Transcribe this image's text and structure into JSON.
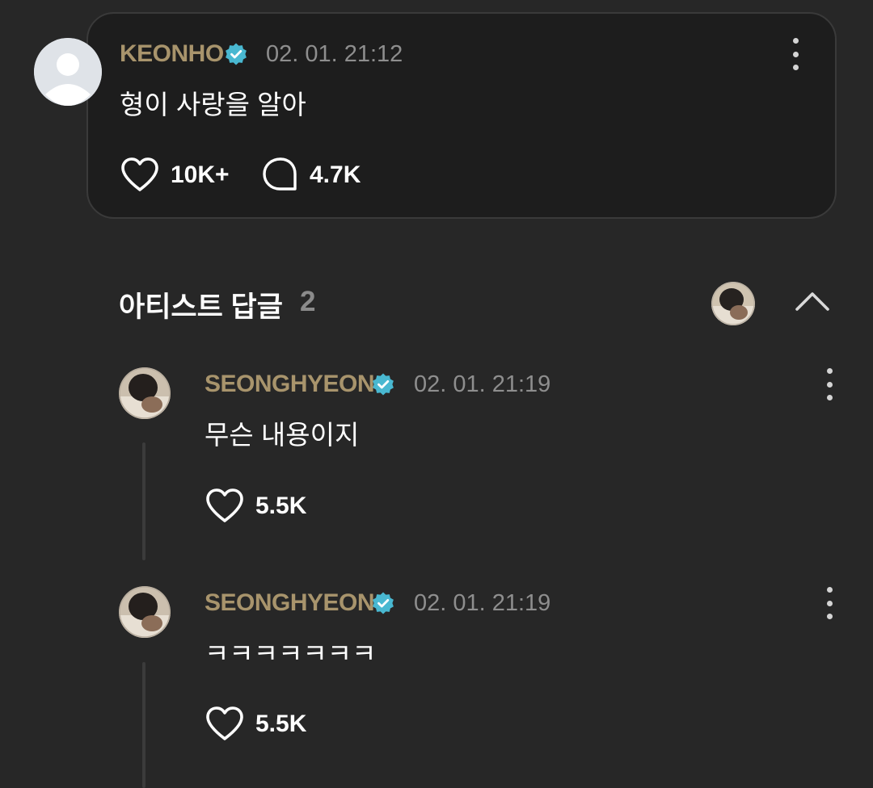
{
  "post": {
    "author": "KEONHO",
    "timestamp": "02. 01. 21:12",
    "text": "형이 사랑을 알아",
    "like_count": "10K+",
    "comment_count": "4.7K"
  },
  "replies_section": {
    "title": "아티스트 답글",
    "count": "2"
  },
  "replies": [
    {
      "author": "SEONGHYEON",
      "timestamp": "02. 01. 21:19",
      "text": "무슨 내용이지",
      "like_count": "5.5K"
    },
    {
      "author": "SEONGHYEON",
      "timestamp": "02. 01. 21:19",
      "text": "ㅋㅋㅋㅋㅋㅋㅋ",
      "like_count": "5.5K"
    }
  ],
  "colors": {
    "background": "#272727",
    "card": "#1d1d1d",
    "author_name": "#a8946c",
    "verified_badge": "#49b8d1",
    "timestamp": "#8e8e8e"
  },
  "icons": {
    "verified": "verified-badge-icon",
    "more": "more-vertical-icon",
    "like": "heart-outline-icon",
    "comment": "speech-bubble-icon",
    "collapse": "chevron-up-icon"
  }
}
